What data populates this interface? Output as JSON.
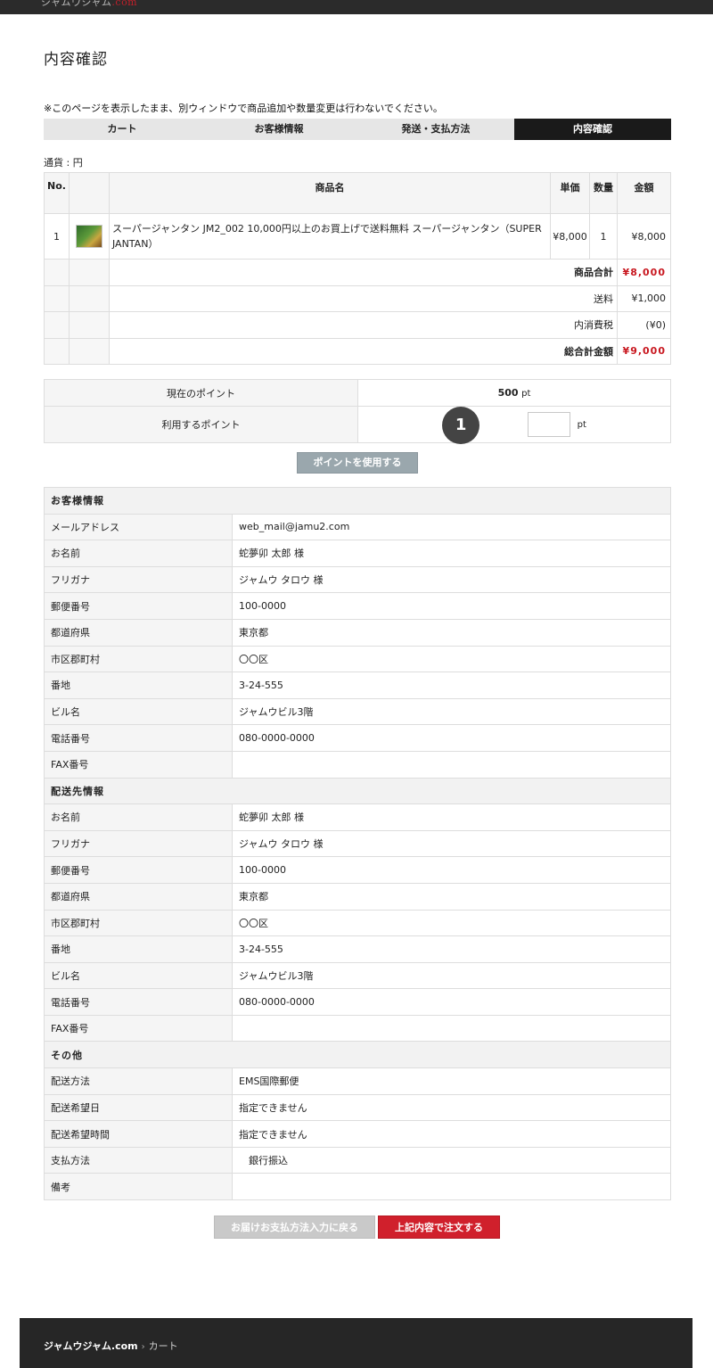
{
  "header": {
    "logo_fragment": "ジャムウジャム",
    "logo_tail": ".com"
  },
  "page": {
    "title": "内容確認",
    "notice": "※このページを表示したまま、別ウィンドウで商品追加や数量変更は行わないでください。",
    "currency": "通貨 : 円"
  },
  "steps": [
    "カート",
    "お客様情報",
    "発送・支払方法",
    "内容確認"
  ],
  "cart": {
    "headers": {
      "no": "No.",
      "name": "商品名",
      "price": "単価",
      "qty": "数量",
      "amount": "金額"
    },
    "item": {
      "no": "1",
      "name": "スーパージャンタン JM2_002 10,000円以上のお買上げで送料無料 スーパージャンタン（SUPER JANTAN）",
      "price": "¥8,000",
      "qty": "1",
      "amount": "¥8,000"
    },
    "subtotal_label": "商品合計",
    "subtotal_value": "¥8,000",
    "shipping_label": "送料",
    "shipping_value": "¥1,000",
    "tax_label": "内消費税",
    "tax_value": "(¥0)",
    "total_label": "総合計金額",
    "total_value": "¥9,000"
  },
  "points": {
    "current_label": "現在のポイント",
    "current_value": "500",
    "unit": "pt",
    "use_label": "利用するポイント",
    "use_value": "",
    "badge": "1",
    "apply_button": "ポイントを使用する"
  },
  "customer": {
    "section": "お客様情報",
    "rows": [
      {
        "k": "メールアドレス",
        "v": "web_mail@jamu2.com"
      },
      {
        "k": "お名前",
        "v": "蛇夢卯 太郎 様"
      },
      {
        "k": "フリガナ",
        "v": "ジャムウ タロウ 様"
      },
      {
        "k": "郵便番号",
        "v": "100-0000"
      },
      {
        "k": "都道府県",
        "v": "東京都"
      },
      {
        "k": "市区郡町村",
        "v": "〇〇区"
      },
      {
        "k": "番地",
        "v": "3-24-555"
      },
      {
        "k": "ビル名",
        "v": "ジャムウビル3階"
      },
      {
        "k": "電話番号",
        "v": "080-0000-0000"
      },
      {
        "k": "FAX番号",
        "v": ""
      }
    ]
  },
  "delivery": {
    "section": "配送先情報",
    "rows": [
      {
        "k": "お名前",
        "v": "蛇夢卯 太郎 様"
      },
      {
        "k": "フリガナ",
        "v": "ジャムウ タロウ 様"
      },
      {
        "k": "郵便番号",
        "v": "100-0000"
      },
      {
        "k": "都道府県",
        "v": "東京都"
      },
      {
        "k": "市区郡町村",
        "v": "〇〇区"
      },
      {
        "k": "番地",
        "v": "3-24-555"
      },
      {
        "k": "ビル名",
        "v": "ジャムウビル3階"
      },
      {
        "k": "電話番号",
        "v": "080-0000-0000"
      },
      {
        "k": "FAX番号",
        "v": ""
      }
    ]
  },
  "other": {
    "section": "その他",
    "rows": [
      {
        "k": "配送方法",
        "v": "EMS国際郵便"
      },
      {
        "k": "配送希望日",
        "v": "指定できません"
      },
      {
        "k": "配送希望時間",
        "v": "指定できません"
      },
      {
        "k": "支払方法",
        "v": "　銀行振込"
      },
      {
        "k": "備考",
        "v": ""
      }
    ]
  },
  "actions": {
    "back": "お届けお支払方法入力に戻る",
    "order": "上記内容で注文する"
  },
  "footer": {
    "home": "ジャムウジャム.com",
    "sep": "›",
    "current": "カート"
  },
  "colors": {
    "accent_red": "#c8171f",
    "dark": "#1a1a1a",
    "button_gray": "#9aa7ad"
  }
}
